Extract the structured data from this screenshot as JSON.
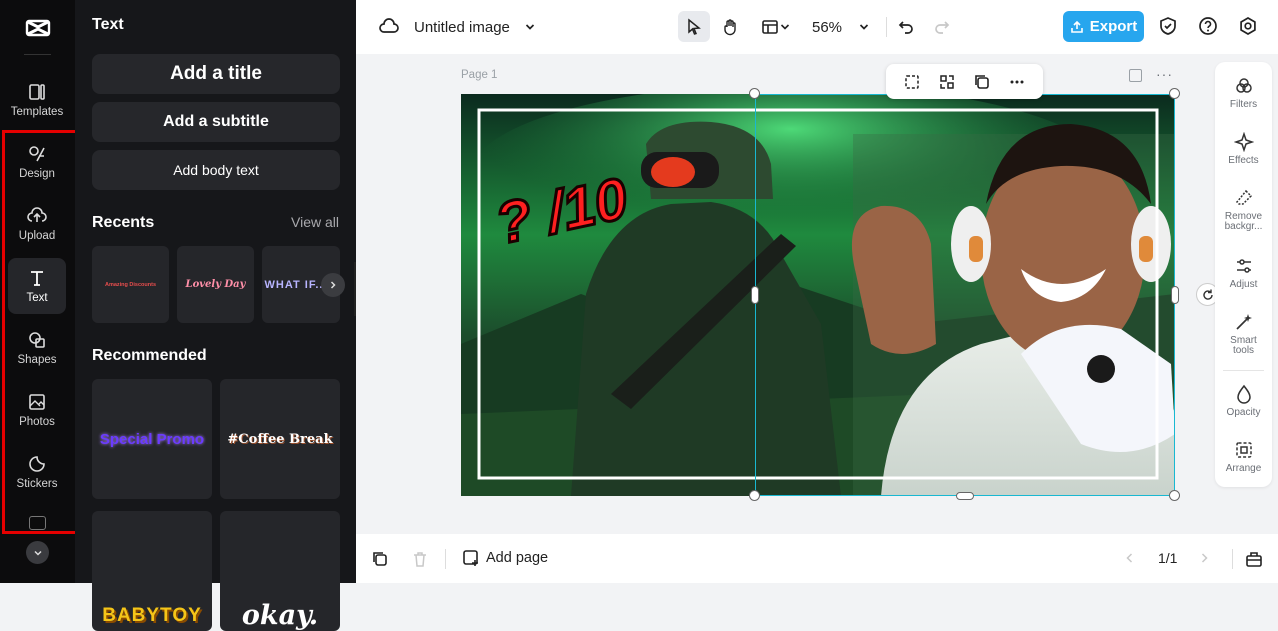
{
  "rail": {
    "items": [
      {
        "label": "Templates",
        "icon": "templates-icon"
      },
      {
        "label": "Design",
        "icon": "design-icon"
      },
      {
        "label": "Upload",
        "icon": "upload-icon"
      },
      {
        "label": "Text",
        "icon": "text-icon"
      },
      {
        "label": "Shapes",
        "icon": "shapes-icon"
      },
      {
        "label": "Photos",
        "icon": "photos-icon"
      },
      {
        "label": "Stickers",
        "icon": "stickers-icon"
      }
    ],
    "active": "Text"
  },
  "panel": {
    "title": "Text",
    "add_title": "Add a title",
    "add_subtitle": "Add a subtitle",
    "add_body": "Add body text",
    "recents_label": "Recents",
    "view_all": "View all",
    "recents": [
      "Amazing Discounts",
      "Lovely Day",
      "WHAT IF.."
    ],
    "recommended_label": "Recommended",
    "recommended": [
      "Special Promo",
      "#Coffee Break",
      "BABYTOY",
      "okay."
    ]
  },
  "topbar": {
    "doc_title": "Untitled image",
    "zoom": "56%",
    "export_label": "Export"
  },
  "canvas": {
    "page_label": "Page 1",
    "rating_text": "? /10"
  },
  "right_panel": {
    "items": [
      "Filters",
      "Effects",
      "Remove backgr...",
      "Adjust",
      "Smart tools",
      "Opacity",
      "Arrange"
    ]
  },
  "bottombar": {
    "add_page": "Add page",
    "page_count": "1/1"
  },
  "colors": {
    "accent": "#27a6ee",
    "highlight": "#e60000",
    "selection": "#19b8d1"
  }
}
